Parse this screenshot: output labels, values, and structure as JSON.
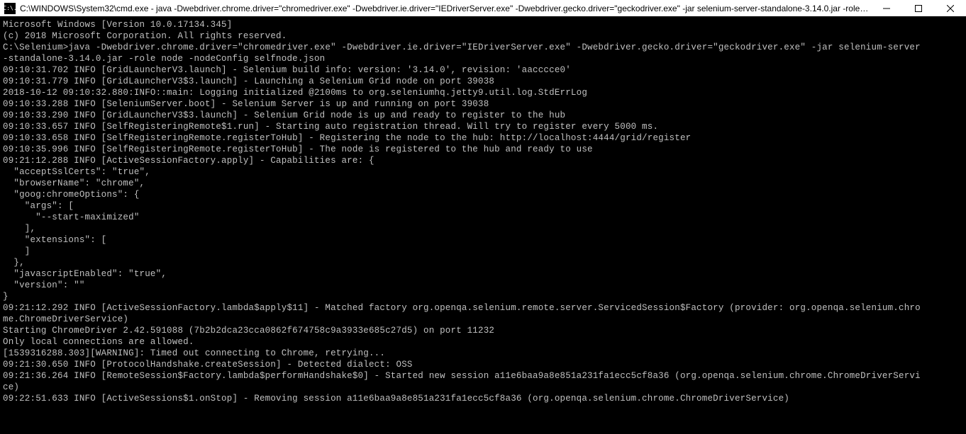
{
  "window": {
    "title": "C:\\WINDOWS\\System32\\cmd.exe - java  -Dwebdriver.chrome.driver=\"chromedriver.exe\" -Dwebdriver.ie.driver=\"IEDriverServer.exe\" -Dwebdriver.gecko.driver=\"geckodriver.exe\" -jar selenium-server-standalone-3.14.0.jar -role no...",
    "icon_label": "C:\\."
  },
  "lines": [
    "Microsoft Windows [Version 10.0.17134.345]",
    "(c) 2018 Microsoft Corporation. All rights reserved.",
    "",
    "C:\\Selenium>java -Dwebdriver.chrome.driver=\"chromedriver.exe\" -Dwebdriver.ie.driver=\"IEDriverServer.exe\" -Dwebdriver.gecko.driver=\"geckodriver.exe\" -jar selenium-server",
    "-standalone-3.14.0.jar -role node -nodeConfig selfnode.json",
    "09:10:31.702 INFO [GridLauncherV3.launch] - Selenium build info: version: '3.14.0', revision: 'aacccce0'",
    "09:10:31.779 INFO [GridLauncherV3$3.launch] - Launching a Selenium Grid node on port 39038",
    "2018-10-12 09:10:32.880:INFO::main: Logging initialized @2100ms to org.seleniumhq.jetty9.util.log.StdErrLog",
    "09:10:33.288 INFO [SeleniumServer.boot] - Selenium Server is up and running on port 39038",
    "09:10:33.290 INFO [GridLauncherV3$3.launch] - Selenium Grid node is up and ready to register to the hub",
    "09:10:33.657 INFO [SelfRegisteringRemote$1.run] - Starting auto registration thread. Will try to register every 5000 ms.",
    "09:10:33.658 INFO [SelfRegisteringRemote.registerToHub] - Registering the node to the hub: http://localhost:4444/grid/register",
    "09:10:35.996 INFO [SelfRegisteringRemote.registerToHub] - The node is registered to the hub and ready to use",
    "09:21:12.288 INFO [ActiveSessionFactory.apply] - Capabilities are: {",
    "  \"acceptSslCerts\": \"true\",",
    "  \"browserName\": \"chrome\",",
    "  \"goog:chromeOptions\": {",
    "    \"args\": [",
    "      \"--start-maximized\"",
    "    ],",
    "    \"extensions\": [",
    "    ]",
    "  },",
    "  \"javascriptEnabled\": \"true\",",
    "  \"version\": \"\"",
    "}",
    "09:21:12.292 INFO [ActiveSessionFactory.lambda$apply$11] - Matched factory org.openqa.selenium.remote.server.ServicedSession$Factory (provider: org.openqa.selenium.chro",
    "me.ChromeDriverService)",
    "Starting ChromeDriver 2.42.591088 (7b2b2dca23cca0862f674758c9a3933e685c27d5) on port 11232",
    "Only local connections are allowed.",
    "[1539316288.303][WARNING]: Timed out connecting to Chrome, retrying...",
    "09:21:30.650 INFO [ProtocolHandshake.createSession] - Detected dialect: OSS",
    "09:21:36.264 INFO [RemoteSession$Factory.lambda$performHandshake$0] - Started new session a11e6baa9a8e851a231fa1ecc5cf8a36 (org.openqa.selenium.chrome.ChromeDriverServi",
    "ce)",
    "09:22:51.633 INFO [ActiveSessions$1.onStop] - Removing session a11e6baa9a8e851a231fa1ecc5cf8a36 (org.openqa.selenium.chrome.ChromeDriverService)"
  ]
}
